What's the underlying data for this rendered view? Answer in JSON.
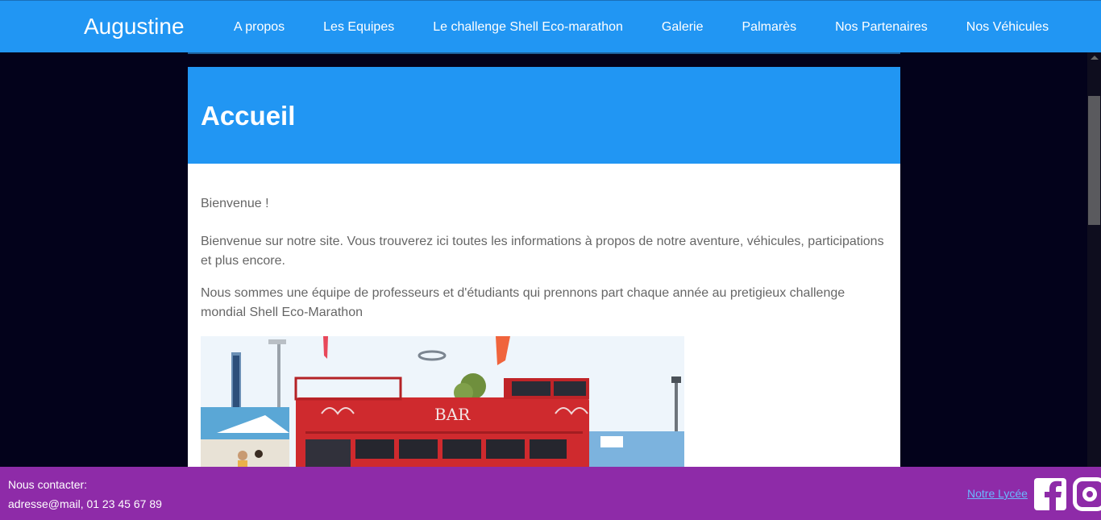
{
  "nav": {
    "brand": "Augustine",
    "items": [
      {
        "label": "A propos"
      },
      {
        "label": "Les Equipes"
      },
      {
        "label": "Le challenge Shell Eco-marathon"
      },
      {
        "label": "Galerie"
      },
      {
        "label": "Palmarès"
      },
      {
        "label": "Nos Partenaires"
      },
      {
        "label": "Nos Véhicules"
      }
    ]
  },
  "page": {
    "title": "Accueil",
    "welcome": "Bienvenue !",
    "intro": "Bienvenue sur notre site. Vous trouverez ici toutes les informations à propos de notre aventure, véhicules, participations et plus encore.",
    "team": "Nous sommes une équipe de professeurs et d'étudiants qui prennons part chaque année au pretigieux challenge mondial Shell Eco-Marathon",
    "photo_sign": "BAR"
  },
  "footer": {
    "contact_title": "Nous contacter:",
    "contact_info": "adresse@mail, 01 23 45 67 89",
    "lycee_link": "Notre Lycée",
    "social": [
      "facebook-icon",
      "instagram-icon"
    ]
  },
  "colors": {
    "nav_bg": "#2196f3",
    "page_bg": "#03021b",
    "footer_bg": "#8e2ba8",
    "link": "#6ab7ff"
  }
}
